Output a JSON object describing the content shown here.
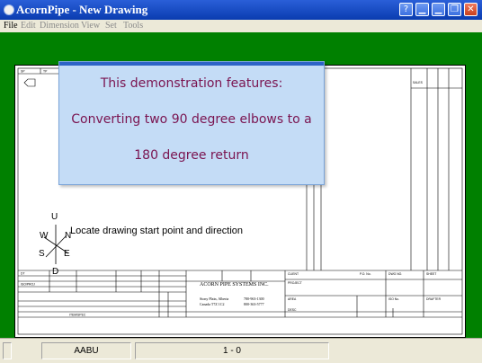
{
  "window": {
    "title": "AcornPipe - New Drawing",
    "app_icon": "acorn-icon",
    "controls": [
      "help-icon",
      "minimize-icon",
      "minimize-icon",
      "restore-icon",
      "close-icon"
    ],
    "title_bar_color": "#0a3cb0"
  },
  "menu": {
    "items": [
      "File",
      "Edit",
      "Dimension",
      "View",
      "Set",
      "Tools"
    ]
  },
  "workspace": {
    "background_color": "#008000"
  },
  "callout": {
    "lines": [
      "This demonstration features:",
      "Converting two 90 degree elbows to a",
      "180 degree return"
    ],
    "text_color": "#7a1450",
    "background_color": "#c4dcf6"
  },
  "compass": {
    "up": "U",
    "north": "N",
    "west": "W",
    "east": "E",
    "south": "S",
    "down": "D",
    "instruction": "Locate drawing start point and direction"
  },
  "title_block": {
    "company": "ACORN PIPE SYSTEMS INC.",
    "address_line1": "Stony Plain, Alberta",
    "address_line2": "Canada T7Z 1C2",
    "phone1": "780-963-1300",
    "phone2": "800-363-5777"
  },
  "statusbar": {
    "panel1": "AABU",
    "panel2": "1 - 0"
  }
}
